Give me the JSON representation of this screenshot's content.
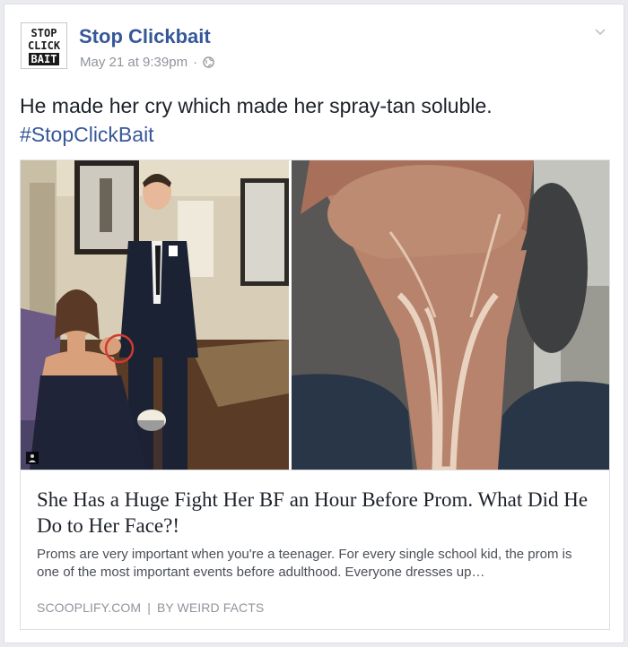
{
  "post": {
    "page_name": "Stop Clickbait",
    "avatar_text": [
      "STOP",
      "CLICK",
      "BAIT"
    ],
    "timestamp": "May 21 at 9:39pm",
    "separator": "·",
    "privacy_icon": "globe-icon",
    "menu_icon": "chevron-down-icon",
    "text": "He made her cry which made her spray-tan soluble.",
    "hashtag": "#StopClickBait"
  },
  "link": {
    "image_left": "prom-photo",
    "image_right": "neck-closeup-photo",
    "title": "She Has a Huge Fight Her BF an Hour Before Prom. What Did He Do to Her Face?!",
    "description": "Proms are very important when you're a teenager. For every single school kid, the prom is one of the most important events before adulthood. Everyone dresses up…",
    "source": "SCOOPLIFY.COM",
    "source_separator": "|",
    "author": "BY WEIRD FACTS"
  },
  "colors": {
    "link_blue": "#365899",
    "meta_gray": "#90949c",
    "text_dark": "#1d2129",
    "background": "#e9ebee"
  }
}
